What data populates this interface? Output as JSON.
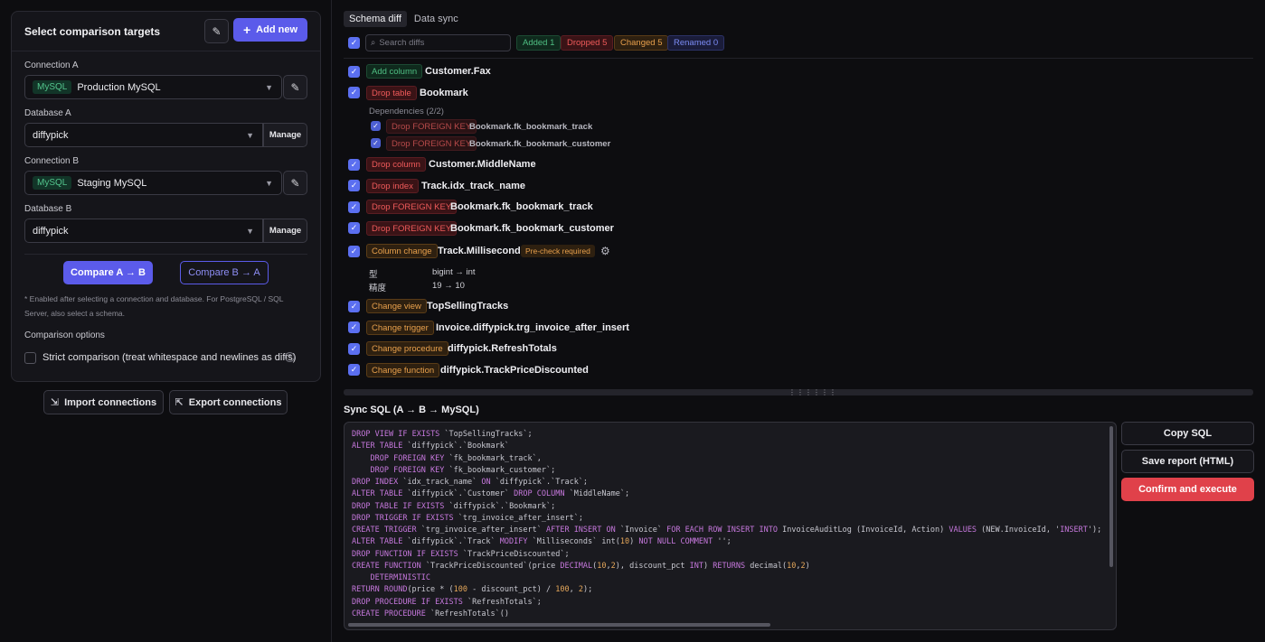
{
  "left": {
    "title": "Select comparison targets",
    "add_new": "Add new",
    "connection_a_label": "Connection A",
    "connection_a_badge": "MySQL",
    "connection_a_value": "Production MySQL",
    "database_a_label": "Database A",
    "database_a_value": "diffypick",
    "manage_label": "Manage",
    "connection_b_label": "Connection B",
    "connection_b_badge": "MySQL",
    "connection_b_value": "Staging MySQL",
    "database_b_label": "Database B",
    "database_b_value": "diffypick",
    "compare_ab": "Compare A → B",
    "compare_ba": "Compare B → A",
    "note": "* Enabled after selecting a connection and database. For PostgreSQL / SQL Server, also select a schema.",
    "options_label": "Comparison options",
    "strict_label": "Strict comparison (treat whitespace and newlines as diffs)",
    "import_btn": "Import connections",
    "export_btn": "Export connections"
  },
  "tabs": [
    {
      "label": "Schema diff",
      "active": true
    },
    {
      "label": "Data sync",
      "active": false
    }
  ],
  "search": {
    "placeholder": "Search diffs"
  },
  "filters": [
    {
      "label": "Added 1",
      "color": "#4fbf83"
    },
    {
      "label": "Dropped 5",
      "color": "#ef5a5a"
    },
    {
      "label": "Changed 5",
      "color": "#e8a04c"
    },
    {
      "label": "Renamed 0",
      "color": "#7c8cf5"
    }
  ],
  "diffs": [
    {
      "tag": "Add column",
      "name": "Customer.Fax"
    },
    {
      "tag": "Drop table",
      "name": "Bookmark"
    },
    {
      "tag": "Drop column",
      "name": "Customer.MiddleName"
    },
    {
      "tag": "Drop index",
      "name": "Track.idx_track_name"
    },
    {
      "tag": "Drop FOREIGN KEY",
      "name": "Bookmark.fk_bookmark_track"
    },
    {
      "tag": "Drop FOREIGN KEY",
      "name": "Bookmark.fk_bookmark_customer"
    },
    {
      "tag": "Column change",
      "name": "Track.Milliseconds",
      "badge": "Pre-check required"
    },
    {
      "tag": "Change view",
      "name": "TopSellingTracks"
    },
    {
      "tag": "Change trigger",
      "name": "Invoice.diffypick.trg_invoice_after_insert"
    },
    {
      "tag": "Change procedure",
      "name": "diffypick.RefreshTotals"
    },
    {
      "tag": "Change function",
      "name": "diffypick.TrackPriceDiscounted"
    }
  ],
  "dependencies": {
    "label": "Dependencies (2/2)",
    "items": [
      {
        "tag": "Drop FOREIGN KEY",
        "name": "Bookmark.fk_bookmark_track"
      },
      {
        "tag": "Drop FOREIGN KEY",
        "name": "Bookmark.fk_bookmark_customer"
      }
    ]
  },
  "column_change_details": [
    {
      "key": "型",
      "value": "bigint → int"
    },
    {
      "key": "精度",
      "value": "19 → 10"
    }
  ],
  "sql": {
    "title": "Sync SQL (A → B → MySQL)",
    "lines": [
      "DROP VIEW IF EXISTS `TopSellingTracks`;",
      "ALTER TABLE `diffypick`.`Bookmark`",
      "    DROP FOREIGN KEY `fk_bookmark_track`,",
      "    DROP FOREIGN KEY `fk_bookmark_customer`;",
      "DROP INDEX `idx_track_name` ON `diffypick`.`Track`;",
      "ALTER TABLE `diffypick`.`Customer` DROP COLUMN `MiddleName`;",
      "DROP TABLE IF EXISTS `diffypick`.`Bookmark`;",
      "DROP TRIGGER IF EXISTS `trg_invoice_after_insert`;",
      "CREATE TRIGGER `trg_invoice_after_insert` AFTER INSERT ON `Invoice` FOR EACH ROW INSERT INTO InvoiceAuditLog (InvoiceId, Action) VALUES (NEW.InvoiceId, 'INSERT');",
      "ALTER TABLE `diffypick`.`Track` MODIFY `Milliseconds` int(10) NOT NULL COMMENT '';",
      "DROP FUNCTION IF EXISTS `TrackPriceDiscounted`;",
      "CREATE FUNCTION `TrackPriceDiscounted`(price DECIMAL(10,2), discount_pct INT) RETURNS decimal(10,2)",
      "    DETERMINISTIC",
      "RETURN ROUND(price * (100 - discount_pct) / 100, 2);",
      "DROP PROCEDURE IF EXISTS `RefreshTotals`;",
      "CREATE PROCEDURE `RefreshTotals`()"
    ]
  },
  "actions": {
    "copy": "Copy SQL",
    "save": "Save report (HTML)",
    "confirm": "Confirm and execute"
  }
}
